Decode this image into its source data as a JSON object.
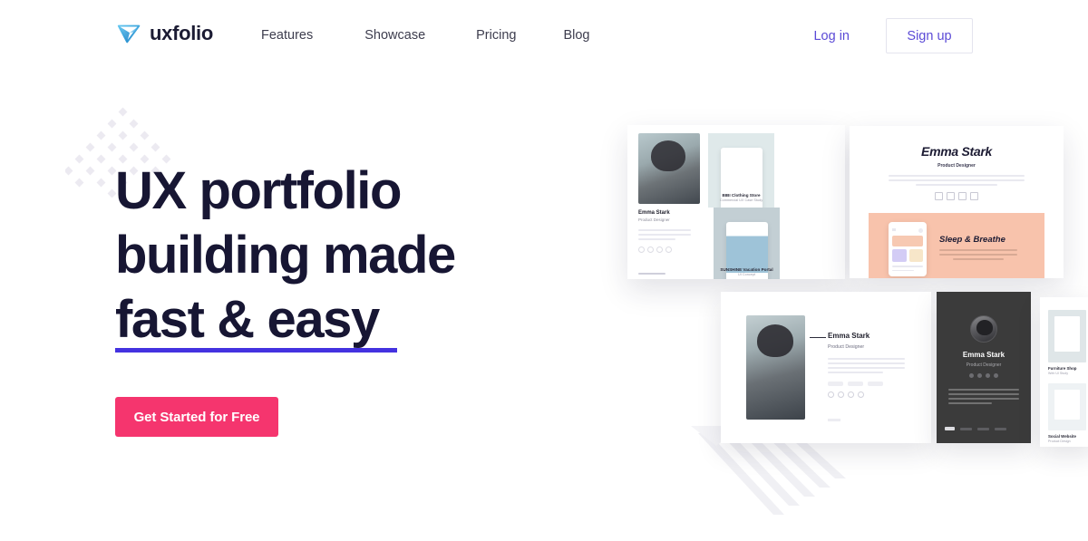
{
  "brand": {
    "name": "uxfolio",
    "logo_icon": "paper-plane-logo-icon",
    "logo_color": "#3aa7e0"
  },
  "nav": {
    "links": [
      {
        "label": "Features"
      },
      {
        "label": "Showcase"
      },
      {
        "label": "Pricing"
      },
      {
        "label": "Blog"
      }
    ],
    "login_label": "Log in",
    "signup_label": "Sign up",
    "link_color": "#3d3d4e",
    "accent_color": "#5b4ad6"
  },
  "hero": {
    "heading_line1": "UX portfolio",
    "heading_line2": "building made",
    "heading_line3": "fast & easy",
    "heading_color": "#171633",
    "underline_color": "#4432e0",
    "cta_label": "Get Started for Free",
    "cta_color": "#f5356e",
    "decor_dots_icon": "diamond-dot-grid-icon",
    "decor_stripes_icon": "diagonal-stripes-icon"
  },
  "mockups": {
    "card1": {
      "name": "Emma Stark",
      "role": "Product Designer",
      "tiles": [
        {
          "title": "BIBI Clothing Store",
          "subtitle": "Commercial UX Case Study"
        },
        {
          "title": "SUNSHINE Vacation Portal",
          "subtitle": "UI Concept"
        }
      ]
    },
    "card2": {
      "name": "Emma Stark",
      "role": "Product Designer",
      "feature_title": "Sleep & Breathe",
      "accent_color": "#f8c3ac"
    },
    "card3": {
      "name": "Emma Stark",
      "role": "Product Designer"
    },
    "card4": {
      "name": "Emma Stark",
      "role": "Product Designer",
      "background": "#3b3b3b"
    },
    "card5": {
      "items": [
        {
          "title": "Furniture Shop",
          "subtitle": "Web UI Study"
        },
        {
          "title": "Social Website",
          "subtitle": "Product Design"
        }
      ]
    }
  }
}
